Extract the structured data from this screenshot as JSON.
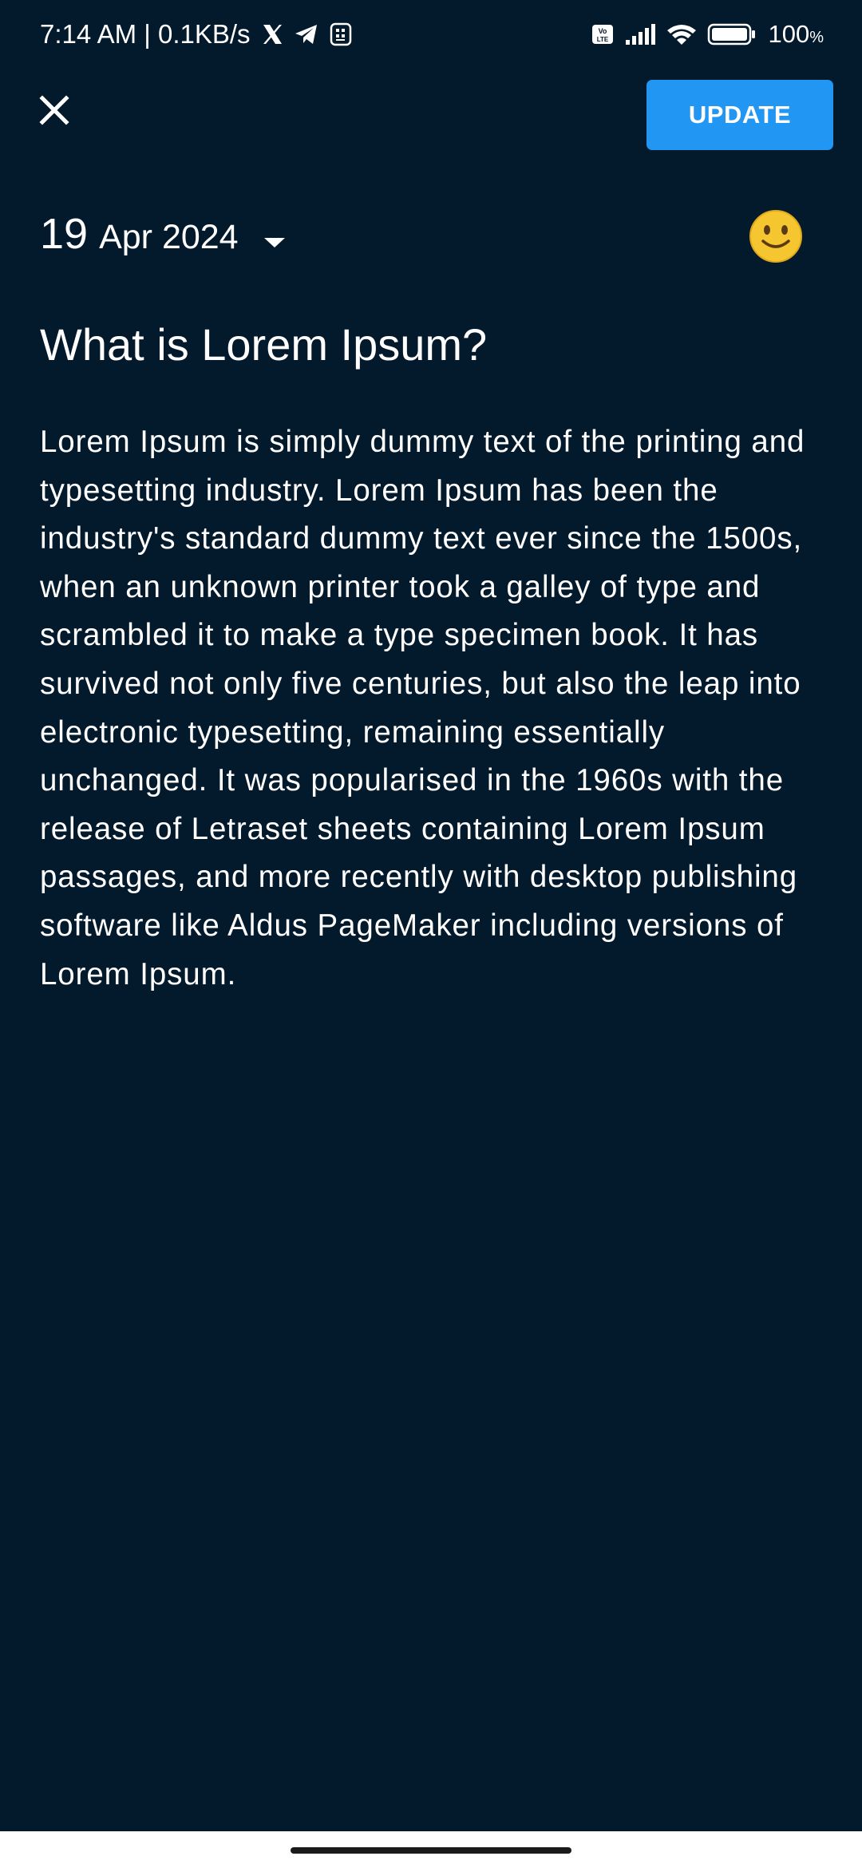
{
  "status_bar": {
    "time_speed": "7:14 AM | 0.1KB/s",
    "battery": "100",
    "battery_unit": "%",
    "icons": [
      "x-icon",
      "telegram-icon",
      "app-notification-icon",
      "volte-icon",
      "signal-icon",
      "wifi-icon",
      "battery-icon"
    ]
  },
  "toolbar": {
    "close_icon": "close-icon",
    "update_label": "UPDATE"
  },
  "entry": {
    "date_day": "19",
    "date_month_year": "Apr 2024",
    "mood_icon": "slightly-smiling-face-icon",
    "mood_emoji": "🙂",
    "title": "What is Lorem Ipsum?",
    "body": "Lorem Ipsum is simply dummy text of the printing and typesetting industry. Lorem Ipsum has been the industry's standard dummy text ever since the 1500s, when an unknown printer took a galley of type and scrambled it to make a type specimen book. It has survived not only five centuries, but also the leap into electronic typesetting, remaining essentially unchanged. It was popularised in the 1960s with the release of Letraset sheets containing Lorem Ipsum passages, and more recently with desktop publishing software like Aldus PageMaker including versions of Lorem Ipsum."
  },
  "colors": {
    "background": "#03192c",
    "accent": "#2196f3",
    "text": "#ffffff",
    "emoji": "#f6c631"
  }
}
